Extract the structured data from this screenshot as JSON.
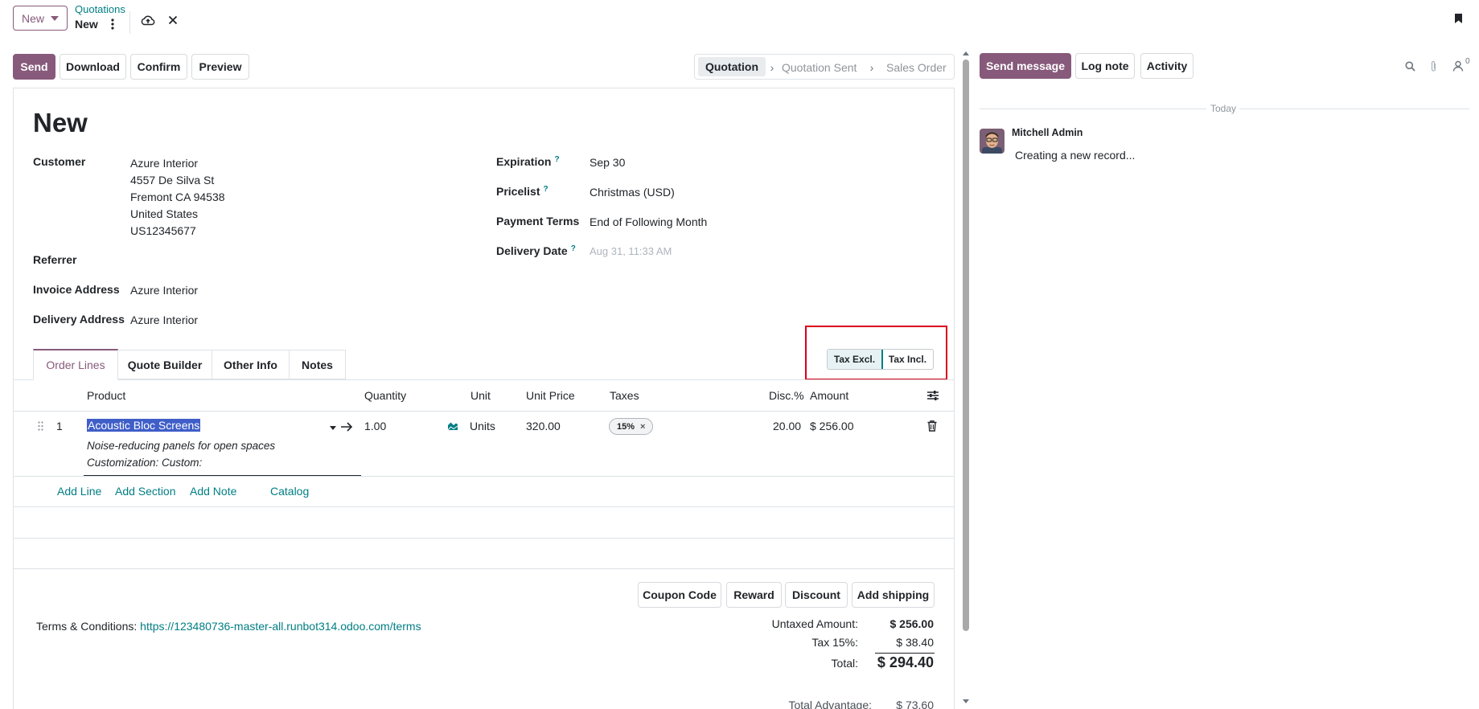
{
  "topbar": {
    "new_button": "New",
    "breadcrumb_parent": "Quotations",
    "breadcrumb_current": "New"
  },
  "actions": {
    "send": "Send",
    "download": "Download",
    "confirm": "Confirm",
    "preview": "Preview"
  },
  "statusbar": [
    "Quotation",
    "Quotation Sent",
    "Sales Order"
  ],
  "form": {
    "title": "New",
    "customer_label": "Customer",
    "customer_lines": [
      "Azure Interior",
      "4557 De Silva St",
      "Fremont CA 94538",
      "United States",
      "US12345677"
    ],
    "referrer_label": "Referrer",
    "invoice_label": "Invoice Address",
    "invoice_value": "Azure Interior",
    "delivery_label": "Delivery Address",
    "delivery_value": "Azure Interior",
    "expiration_label": "Expiration",
    "expiration_value": "Sep 30",
    "pricelist_label": "Pricelist",
    "pricelist_value": "Christmas (USD)",
    "payment_label": "Payment Terms",
    "payment_value": "End of Following Month",
    "delivery_date_label": "Delivery Date",
    "delivery_date_placeholder": "Aug 31, 11:33 AM",
    "help_mark": "?"
  },
  "tax_toggle": {
    "excl": "Tax Excl.",
    "incl": "Tax Incl.",
    "active": "excl"
  },
  "tabs": [
    "Order Lines",
    "Quote Builder",
    "Other Info",
    "Notes"
  ],
  "table": {
    "headers": {
      "product": "Product",
      "quantity": "Quantity",
      "unit": "Unit",
      "unit_price": "Unit Price",
      "taxes": "Taxes",
      "disc": "Disc.%",
      "amount": "Amount"
    },
    "row": {
      "seq": "1",
      "product": "Acoustic Bloc Screens",
      "desc1": "Noise-reducing panels for open spaces",
      "desc2": "Customization: Custom:",
      "quantity": "1.00",
      "unit": "Units",
      "unit_price": "320.00",
      "tax": "15%",
      "disc": "20.00",
      "amount": "$ 256.00"
    },
    "add_line": "Add Line",
    "add_section": "Add Section",
    "add_note": "Add Note",
    "catalog": "Catalog"
  },
  "footer_buttons": {
    "coupon": "Coupon Code",
    "reward": "Reward",
    "discount": "Discount",
    "shipping": "Add shipping"
  },
  "terms": {
    "label": "Terms & Conditions:",
    "url": "https://123480736-master-all.runbot314.odoo.com/terms"
  },
  "totals": {
    "untaxed_label": "Untaxed Amount:",
    "untaxed_value": "$ 256.00",
    "tax_label": "Tax 15%:",
    "tax_value": "$ 38.40",
    "total_label": "Total:",
    "total_value": "$ 294.40",
    "advantage_label": "Total Advantage:",
    "advantage_value": "$ 73.60"
  },
  "chatter": {
    "send_message": "Send message",
    "log_note": "Log note",
    "activity": "Activity",
    "follower_count": "0",
    "today": "Today",
    "author": "Mitchell Admin",
    "message": "Creating a new record..."
  },
  "colors": {
    "brand": "#875a7b",
    "link": "#017e84",
    "highlight_box": "#d9001b",
    "selection": "#3f5ec8"
  }
}
